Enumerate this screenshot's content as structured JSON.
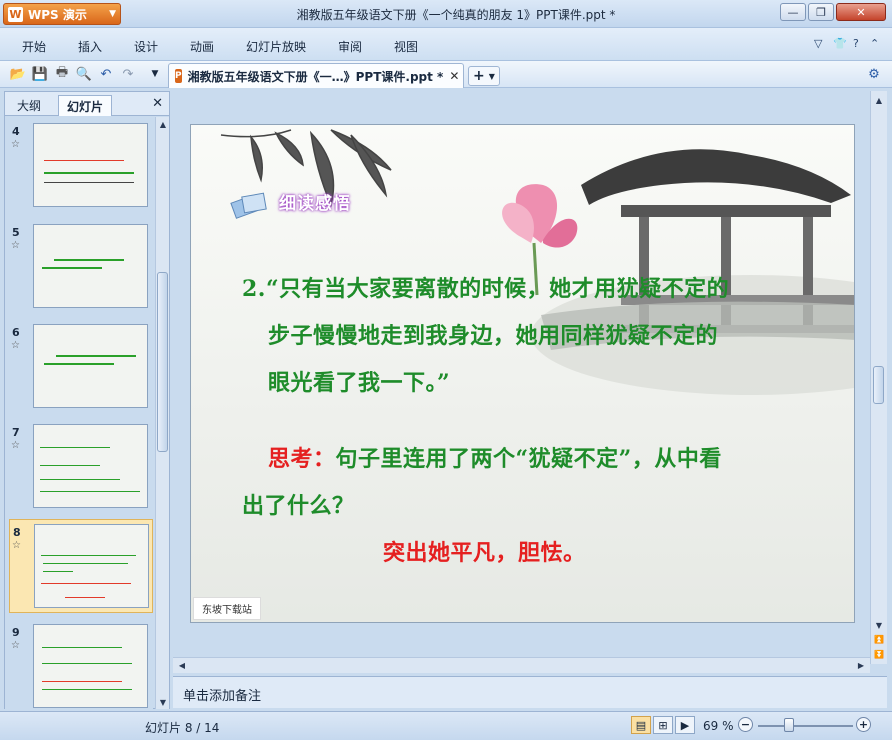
{
  "app": {
    "name": "WPS 演示",
    "window_title": "湘教版五年级语文下册《一个纯真的朋友 1》PPT课件.ppt *"
  },
  "menu": {
    "items": [
      "开始",
      "插入",
      "设计",
      "动画",
      "幻灯片放映",
      "审阅",
      "视图"
    ]
  },
  "document_tab": {
    "label": "湘教版五年级语文下册《一…》PPT课件.ppt *"
  },
  "left_panel": {
    "tabs": [
      "大纲",
      "幻灯片"
    ],
    "active_tab": "幻灯片",
    "thumbnails": [
      {
        "number": "4",
        "star": "☆"
      },
      {
        "number": "5",
        "star": "☆"
      },
      {
        "number": "6",
        "star": "☆"
      },
      {
        "number": "7",
        "star": "☆"
      },
      {
        "number": "8",
        "star": "☆",
        "selected": true
      },
      {
        "number": "9",
        "star": "☆"
      }
    ]
  },
  "slide": {
    "heading": "细读感悟",
    "lines": [
      {
        "text": "2.“只有当大家要离散的时候，她才用犹疑不定的",
        "color": "green"
      },
      {
        "text": "步子慢慢地走到我身边，她用同样犹疑不定的",
        "color": "green"
      },
      {
        "text": "眼光看了我一下。”",
        "color": "green"
      }
    ],
    "question_label": "思考：",
    "question_rest": "句子里连用了两个“犹疑不定”，从中看",
    "question_line2": "出了什么？",
    "answer": "突出她平凡，胆怯。",
    "watermark": "东坡下载站",
    "colors": {
      "green": "#1e8c2a",
      "red": "#e52020"
    }
  },
  "notes": {
    "placeholder": "单击添加备注"
  },
  "status": {
    "slide_indicator": "幻灯片 8 / 14",
    "zoom": "69 %"
  }
}
